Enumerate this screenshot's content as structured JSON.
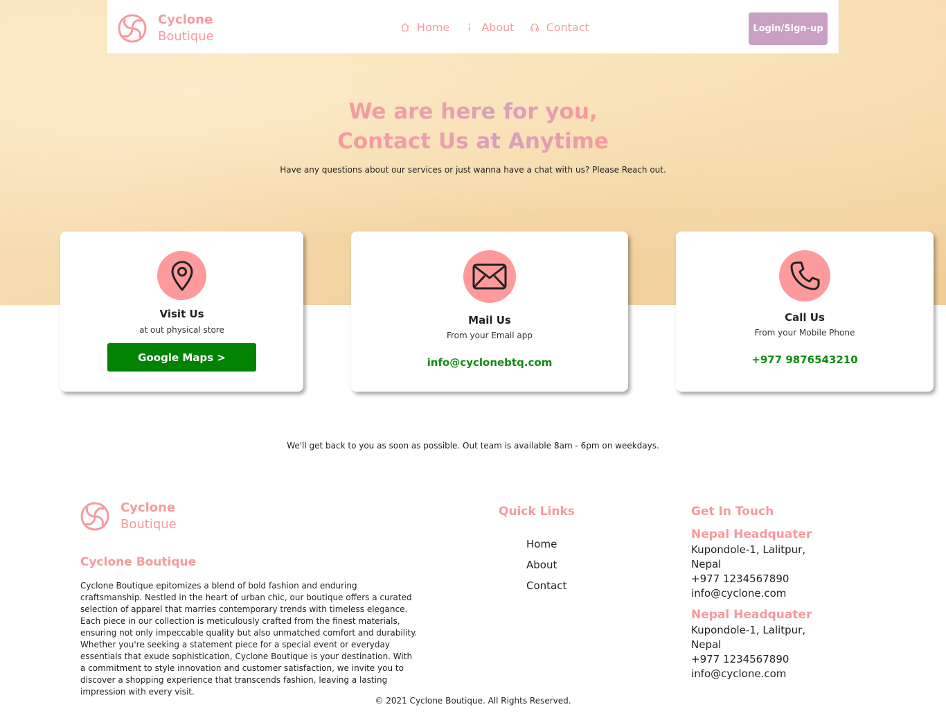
{
  "nav": {
    "brand_name": "Cyclone",
    "brand_sub": "Boutique",
    "links": [
      {
        "label": "Home",
        "icon": "home-icon"
      },
      {
        "label": "About",
        "icon": "info-icon"
      },
      {
        "label": "Contact",
        "icon": "headphones-icon"
      }
    ],
    "login_label": "Login/Sign-up"
  },
  "hero": {
    "title_line1": "We are here for you,",
    "title_line2": "Contact Us at Anytime",
    "subtitle": "Have any questions about our services or just wanna have a chat with us? Please Reach out."
  },
  "cards": {
    "visit": {
      "title": "Visit Us",
      "sub": "at out physical store",
      "button": "Google Maps >",
      "icon": "map-pin-icon"
    },
    "mail": {
      "title": "Mail Us",
      "sub": "From your Email app",
      "value": "info@cyclonebtq.com",
      "icon": "envelope-icon"
    },
    "call": {
      "title": "Call Us",
      "sub": "From your Mobile Phone",
      "value": "+977 9876543210",
      "icon": "phone-icon"
    }
  },
  "availability": "We'll get back to you as soon as possible. Out team is available 8am - 6pm on weekdays.",
  "footer": {
    "brand_name": "Cyclone",
    "brand_sub": "Boutique",
    "about_heading": "Cyclone Boutique",
    "about_text": "Cyclone Boutique epitomizes a blend of bold fashion and enduring craftsmanship. Nestled in the heart of urban chic, our boutique offers a curated selection of apparel that marries contemporary trends with timeless elegance. Each piece in our collection is meticulously crafted from the finest materials, ensuring not only impeccable quality but also unmatched comfort and durability. Whether you're seeking a statement piece for a special event or everyday essentials that exude sophistication, Cyclone Boutique is your destination. With a commitment to style innovation and customer satisfaction, we invite you to discover a shopping experience that transcends fashion, leaving a lasting impression with every visit.",
    "quick_links_heading": "Quick Links",
    "quick_links": [
      "Home",
      "About",
      "Contact"
    ],
    "get_in_touch_heading": "Get In Touch",
    "offices": [
      {
        "name": "Nepal Headquater",
        "address1": "Kupondole-1, Lalitpur,",
        "address2": "Nepal",
        "phone": "+977 1234567890",
        "email": "info@cyclone.com"
      },
      {
        "name": "Nepal Headquater",
        "address1": "Kupondole-1, Lalitpur,",
        "address2": "Nepal",
        "phone": "+977 1234567890",
        "email": "info@cyclone.com"
      }
    ],
    "copyright": "© 2021 Cyclone Boutique. All Rights Reserved."
  },
  "colors": {
    "accent_pink": "#f79a9e",
    "circle_pink": "#fd9a9c",
    "login_purple": "#c9a0c2",
    "green": "#038303",
    "value_green": "#118a11"
  }
}
